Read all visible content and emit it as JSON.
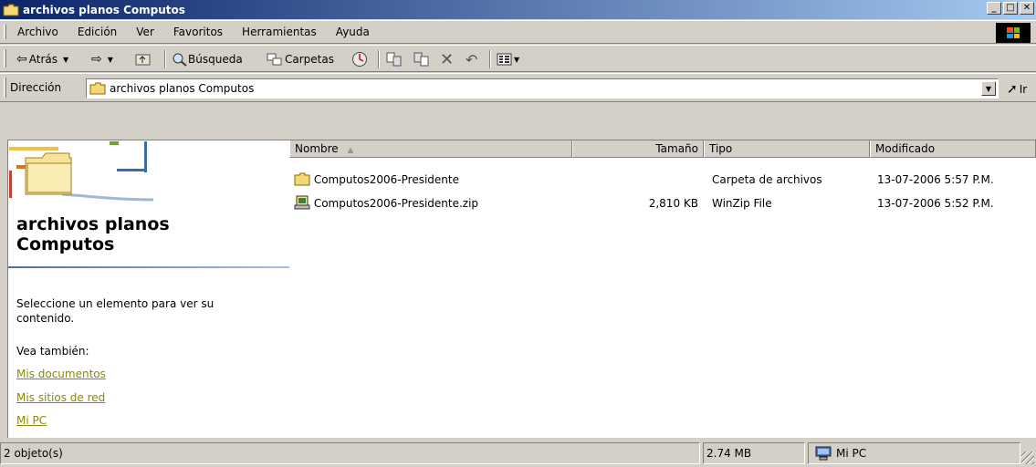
{
  "window": {
    "title": "archivos planos Computos"
  },
  "menu": {
    "items": [
      "Archivo",
      "Edición",
      "Ver",
      "Favoritos",
      "Herramientas",
      "Ayuda"
    ]
  },
  "toolbar": {
    "back_label": "Atrás",
    "search_label": "Búsqueda",
    "folders_label": "Carpetas"
  },
  "address": {
    "label": "Dirección",
    "value": "archivos planos Computos",
    "go_label": "Ir"
  },
  "left_pane": {
    "title_line1": "archivos planos",
    "title_line2": "Computos",
    "hint_line1": "Seleccione un elemento para ver su",
    "hint_line2": "contenido.",
    "see_also": "Vea también:",
    "links": [
      "Mis documentos",
      "Mis sitios de red",
      "Mi PC"
    ]
  },
  "columns": {
    "name": "Nombre",
    "size": "Tamaño",
    "type": "Tipo",
    "modified": "Modificado"
  },
  "files": [
    {
      "name": "Computos2006-Presidente",
      "size": "",
      "type": "Carpeta de archivos",
      "modified": "13-07-2006 5:57 P.M.",
      "icon": "folder-icon"
    },
    {
      "name": "Computos2006-Presidente.zip",
      "size": "2,810 KB",
      "type": "WinZip File",
      "modified": "13-07-2006 5:52 P.M.",
      "icon": "winzip-icon"
    }
  ],
  "status": {
    "objects": "2 objeto(s)",
    "size": "2.74 MB",
    "zone": "Mi PC"
  }
}
